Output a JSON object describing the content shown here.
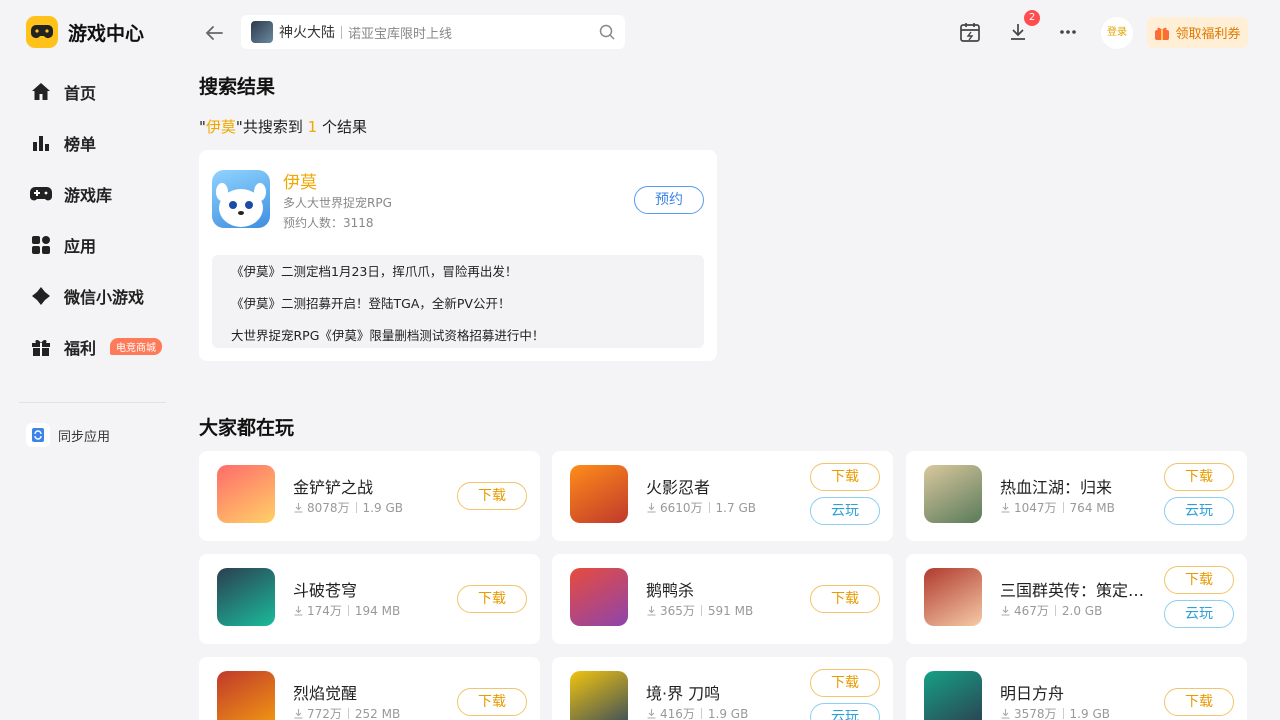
{
  "app": {
    "title": "游戏中心"
  },
  "sidebar": {
    "items": [
      {
        "label": "首页",
        "icon": "home-icon"
      },
      {
        "label": "榜单",
        "icon": "ranking-icon"
      },
      {
        "label": "游戏库",
        "icon": "gamepad-icon"
      },
      {
        "label": "应用",
        "icon": "apps-icon"
      },
      {
        "label": "微信小游戏",
        "icon": "mini-game-icon"
      },
      {
        "label": "福利",
        "icon": "gift-icon",
        "badge": "电竞商城"
      }
    ],
    "sync_label": "同步应用"
  },
  "topbar": {
    "search_game": "神火大陆",
    "search_hint": "诺亚宝库限时上线",
    "download_badge": "2",
    "login_label": "登录",
    "coupon_label": "领取福利券"
  },
  "search_results": {
    "title": "搜索结果",
    "prefix": "\"",
    "query": "伊莫",
    "middle": "\"共搜索到",
    "count": "1",
    "suffix": "个结果",
    "game": {
      "name": "伊莫",
      "desc": "多人大世界捉宠RPG",
      "reserve_count": "预约人数：3118",
      "reserve_label": "预约",
      "news": [
        "《伊莫》二测定档1月23日，挥爪爪，冒险再出发！",
        "《伊莫》二测招募开启！登陆TGA，全新PV公开！",
        "大世界捉宠RPG《伊莫》限量删档测试资格招募进行中！"
      ]
    }
  },
  "popular": {
    "title": "大家都在玩",
    "download_label": "下载",
    "cloud_label": "云玩",
    "games": [
      {
        "name": "金铲铲之战",
        "downloads": "8078万",
        "size": "1.9 GB",
        "cloud": false
      },
      {
        "name": "火影忍者",
        "downloads": "6610万",
        "size": "1.7 GB",
        "cloud": true
      },
      {
        "name": "热血江湖：归来",
        "downloads": "1047万",
        "size": "764 MB",
        "cloud": true
      },
      {
        "name": "斗破苍穹",
        "downloads": "174万",
        "size": "194 MB",
        "cloud": false
      },
      {
        "name": "鹅鸭杀",
        "downloads": "365万",
        "size": "591 MB",
        "cloud": false
      },
      {
        "name": "三国群英传：策定…",
        "downloads": "467万",
        "size": "2.0 GB",
        "cloud": true
      },
      {
        "name": "烈焰觉醒",
        "downloads": "772万",
        "size": "252 MB",
        "cloud": false
      },
      {
        "name": "境·界 刀鸣",
        "downloads": "416万",
        "size": "1.9 GB",
        "cloud": true
      },
      {
        "name": "明日方舟",
        "downloads": "3578万",
        "size": "1.9 GB",
        "cloud": false
      }
    ]
  },
  "colors": {
    "accent": "#f0a800",
    "blue": "#3d84e8",
    "cloud": "#2f9fd8",
    "background": "#f4f4f6"
  }
}
